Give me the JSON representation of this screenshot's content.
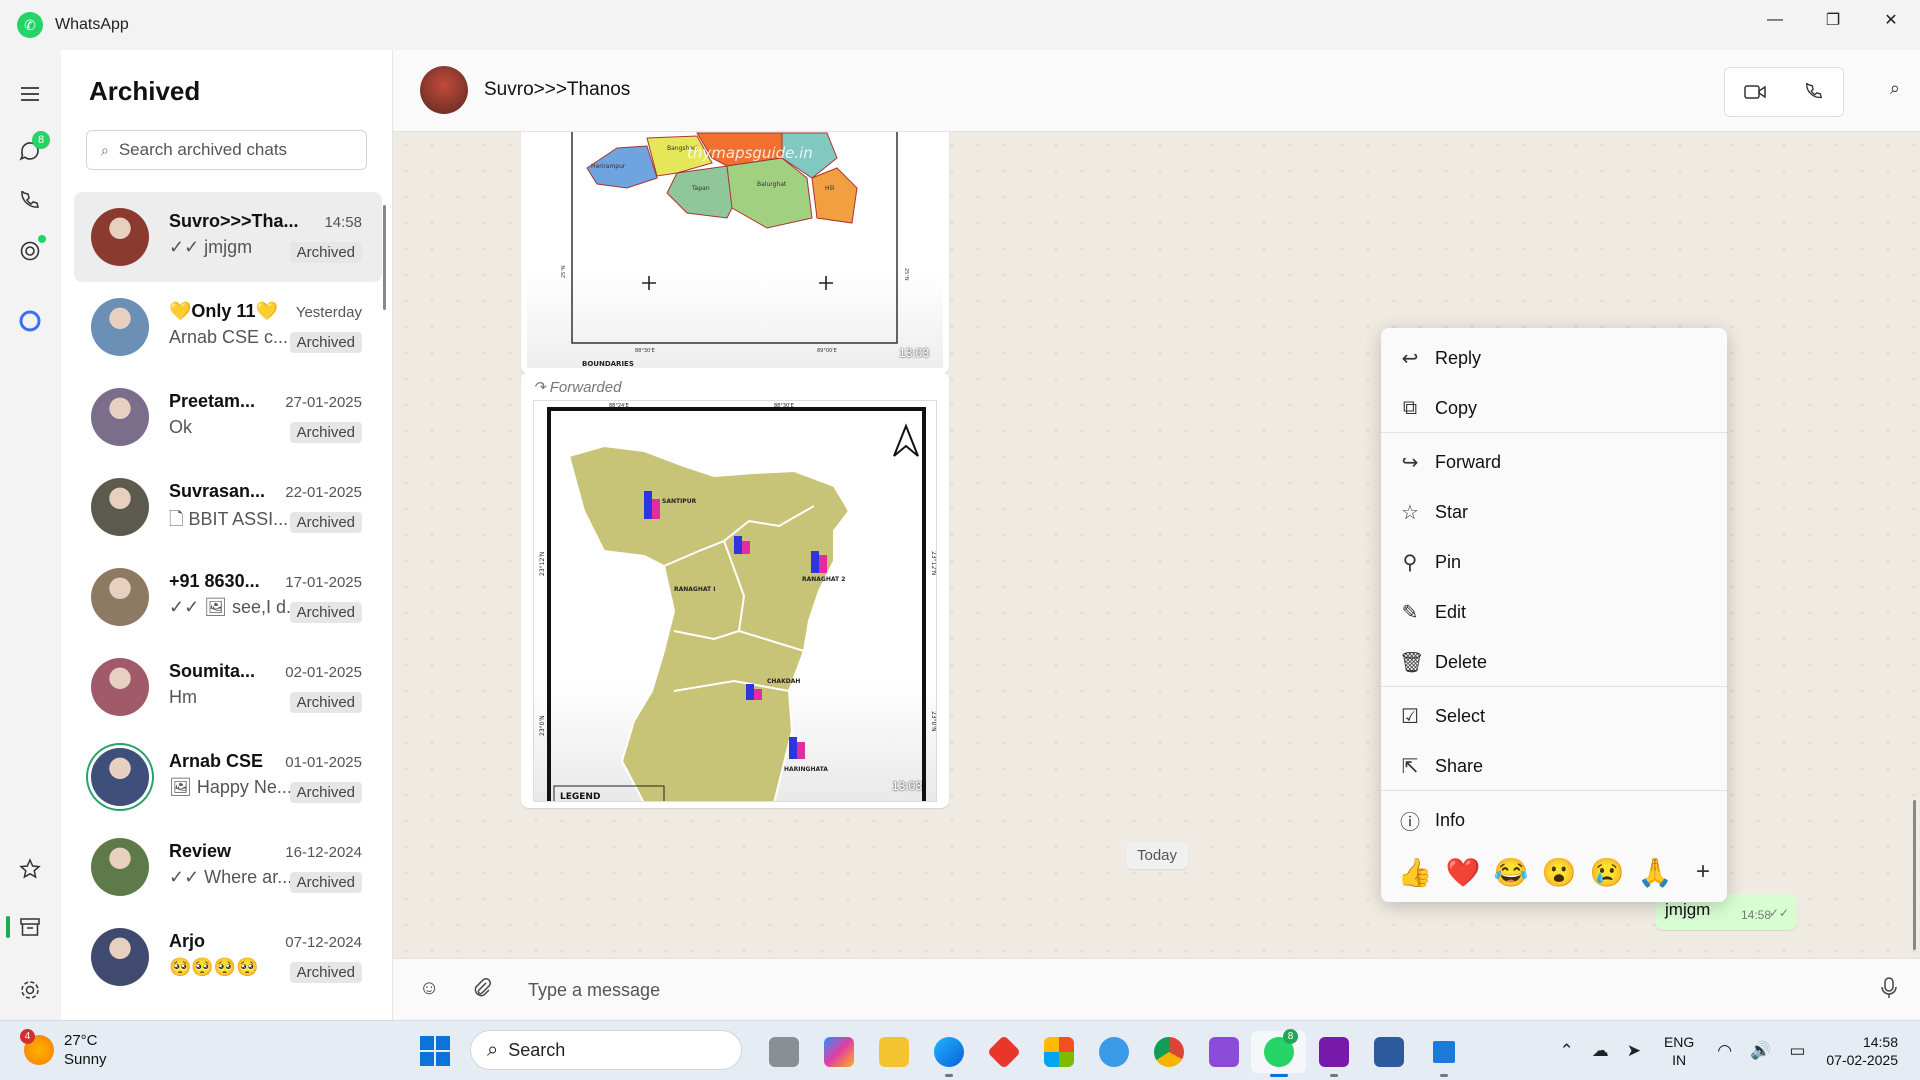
{
  "app": {
    "title": "WhatsApp"
  },
  "window_controls": {
    "minimize": "—",
    "restore": "❐",
    "close": "✕"
  },
  "rail": {
    "chats_badge": "8"
  },
  "list": {
    "heading": "Archived",
    "search_placeholder": "Search archived chats",
    "chats": [
      {
        "name": "Suvro>>>Tha...",
        "time": "14:58",
        "preview": "✓✓ jmjgm",
        "badge": "Archived",
        "color": "#8a3a2e"
      },
      {
        "name": "💛Only 11💛",
        "time": "Yesterday",
        "preview": "Arnab CSE c...",
        "badge": "Archived",
        "color": "#6b8fb5"
      },
      {
        "name": "Preetam...",
        "time": "27-01-2025",
        "preview": "Ok",
        "badge": "Archived",
        "color": "#7a6e8a"
      },
      {
        "name": "Suvrasan...",
        "time": "22-01-2025",
        "preview": "🗋 BBIT ASSI...",
        "badge": "Archived",
        "color": "#5c5a4e"
      },
      {
        "name": "+91 8630...",
        "time": "17-01-2025",
        "preview": "✓✓ 🖼 see,I d...",
        "badge": "Archived",
        "color": "#8c7a62"
      },
      {
        "name": "Soumita...",
        "time": "02-01-2025",
        "preview": "Hm",
        "badge": "Archived",
        "color": "#a05a6a"
      },
      {
        "name": "Arnab CSE",
        "time": "01-01-2025",
        "preview": "🖼 Happy Ne...",
        "badge": "Archived",
        "color": "#3d4f7a"
      },
      {
        "name": "Review",
        "time": "16-12-2024",
        "preview": "✓✓ Where ar...",
        "badge": "Archived",
        "color": "#5e7a4a"
      },
      {
        "name": "Arjo",
        "time": "07-12-2024",
        "preview": "🥺🥺🥺🥺",
        "badge": "Archived",
        "color": "#3f4a6e"
      }
    ]
  },
  "conversation": {
    "contact_name": "Suvro>>>Thanos",
    "messages": {
      "image1_time": "13:03",
      "forwarded_label": "Forwarded",
      "image2_time": "13:03",
      "date_divider": "Today",
      "outgoing_text": "jmjgm",
      "outgoing_time": "14:58"
    },
    "map1": {
      "watermark": "thymapsguide.in",
      "labels": [
        "Bangshari",
        "Harirampur",
        "Tapan",
        "Balurghat",
        "Hili"
      ],
      "lat_left": "25°N",
      "lat_right": "25°N",
      "bottom_label": "BOUNDARIES",
      "tick_left": "88°30'E",
      "tick_right": "89°00'E"
    },
    "map2": {
      "labels": [
        "SANTIPUR",
        "RANAGHAT I",
        "RANAGHAT 2",
        "CHAKDAH",
        "HARINGHATA"
      ],
      "lat_left_top": "23°12'N",
      "lat_right_top": "23°12'N",
      "lat_left_bottom": "23°0'N",
      "lat_right_bottom": "23°0'N",
      "tick_top_left": "88°24'E",
      "tick_top_right": "88°30'E",
      "legend": "LEGEND"
    },
    "composer_placeholder": "Type a message"
  },
  "context_menu": {
    "items": [
      "Reply",
      "Copy",
      "Forward",
      "Star",
      "Pin",
      "Edit",
      "Delete",
      "Select",
      "Share",
      "Info"
    ],
    "reactions": [
      "👍",
      "❤️",
      "😂",
      "😮",
      "😢",
      "🙏",
      "+"
    ]
  },
  "taskbar": {
    "weather_badge": "4",
    "temperature": "27°C",
    "condition": "Sunny",
    "search_label": "Search",
    "whatsapp_badge": "8",
    "lang_line1": "ENG",
    "lang_line2": "IN",
    "time": "14:58",
    "date": "07-02-2025"
  }
}
